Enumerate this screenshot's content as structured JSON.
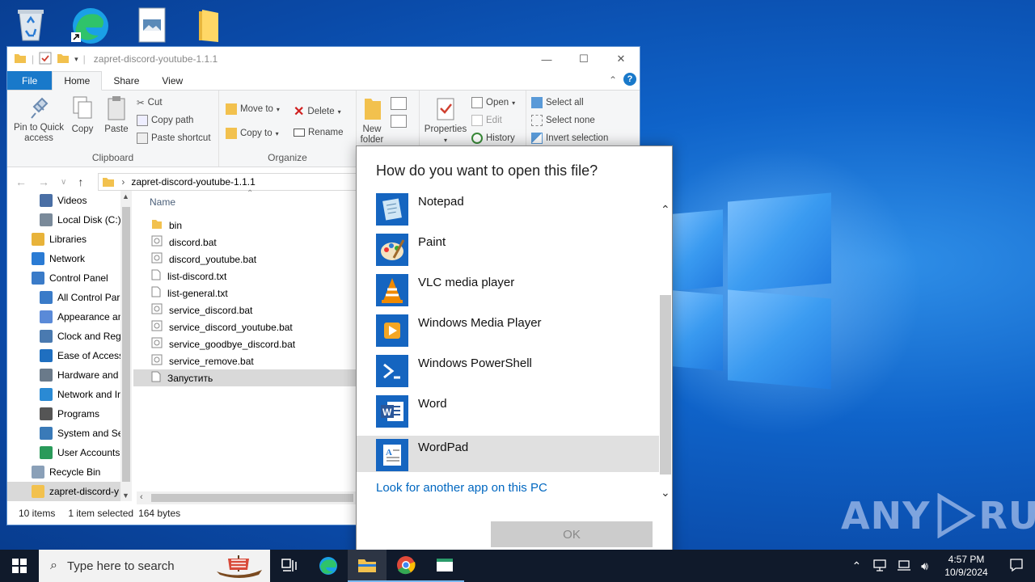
{
  "explorer": {
    "title": "zapret-discord-youtube-1.1.1",
    "tabs": [
      "File",
      "Home",
      "Share",
      "View"
    ],
    "ribbon": {
      "pin_label": "Pin to Quick access",
      "copy_label": "Copy",
      "paste_label": "Paste",
      "cut_label": "Cut",
      "copy_path_label": "Copy path",
      "paste_shortcut_label": "Paste shortcut",
      "clipboard_group": "Clipboard",
      "move_to_label": "Move to",
      "copy_to_label": "Copy to",
      "delete_label": "Delete",
      "rename_label": "Rename",
      "organize_group": "Organize",
      "new_folder_label": "New folder",
      "properties_label": "Properties",
      "open_label": "Open",
      "edit_label": "Edit",
      "history_label": "History",
      "select_all_label": "Select all",
      "select_none_label": "Select none",
      "invert_selection_label": "Invert selection"
    },
    "address_path": "zapret-discord-youtube-1.1.1",
    "nav_items": [
      {
        "label": "Videos",
        "icon": "videos-icon",
        "indent": 1
      },
      {
        "label": "Local Disk (C:)",
        "icon": "drive-icon",
        "indent": 1
      },
      {
        "label": "Libraries",
        "icon": "libraries-icon",
        "indent": 0
      },
      {
        "label": "Network",
        "icon": "network-icon",
        "indent": 0
      },
      {
        "label": "Control Panel",
        "icon": "control-panel-icon",
        "indent": 0
      },
      {
        "label": "All Control Par",
        "icon": "control-panel-icon",
        "indent": 1
      },
      {
        "label": "Appearance an",
        "icon": "appearance-icon",
        "indent": 1
      },
      {
        "label": "Clock and Regi",
        "icon": "clock-icon",
        "indent": 1
      },
      {
        "label": "Ease of Access",
        "icon": "ease-of-access-icon",
        "indent": 1
      },
      {
        "label": "Hardware and",
        "icon": "hardware-icon",
        "indent": 1
      },
      {
        "label": "Network and Ir",
        "icon": "network-internet-icon",
        "indent": 1
      },
      {
        "label": "Programs",
        "icon": "programs-icon",
        "indent": 1
      },
      {
        "label": "System and Sec",
        "icon": "system-security-icon",
        "indent": 1
      },
      {
        "label": "User Accounts",
        "icon": "user-accounts-icon",
        "indent": 1
      },
      {
        "label": "Recycle Bin",
        "icon": "recycle-bin-icon",
        "indent": 0
      },
      {
        "label": "zapret-discord-y",
        "icon": "folder-icon",
        "indent": 0
      }
    ],
    "column_name": "Name",
    "files": [
      {
        "name": "bin",
        "type": "folder"
      },
      {
        "name": "discord.bat",
        "type": "bat"
      },
      {
        "name": "discord_youtube.bat",
        "type": "bat"
      },
      {
        "name": "list-discord.txt",
        "type": "txt"
      },
      {
        "name": "list-general.txt",
        "type": "txt"
      },
      {
        "name": "service_discord.bat",
        "type": "bat"
      },
      {
        "name": "service_discord_youtube.bat",
        "type": "bat"
      },
      {
        "name": "service_goodbye_discord.bat",
        "type": "bat"
      },
      {
        "name": "service_remove.bat",
        "type": "bat"
      },
      {
        "name": "Запустить",
        "type": "file"
      }
    ],
    "status": {
      "items_count": "10 items",
      "selected": "1 item selected",
      "size": "164 bytes"
    }
  },
  "dialog": {
    "title": "How do you want to open this file?",
    "apps": [
      {
        "name": "Notepad",
        "icon": "notepad-icon"
      },
      {
        "name": "Paint",
        "icon": "paint-icon"
      },
      {
        "name": "VLC media player",
        "icon": "vlc-icon"
      },
      {
        "name": "Windows Media Player",
        "icon": "media-player-icon"
      },
      {
        "name": "Windows PowerShell",
        "icon": "powershell-icon"
      },
      {
        "name": "Word",
        "icon": "word-icon"
      },
      {
        "name": "WordPad",
        "icon": "wordpad-icon"
      }
    ],
    "selected_app": "WordPad",
    "look_link": "Look for another app on this PC",
    "ok_label": "OK"
  },
  "taskbar": {
    "search_placeholder": "Type here to search",
    "time": "4:57 PM",
    "date": "10/9/2024"
  },
  "watermark": "ANY RUN"
}
